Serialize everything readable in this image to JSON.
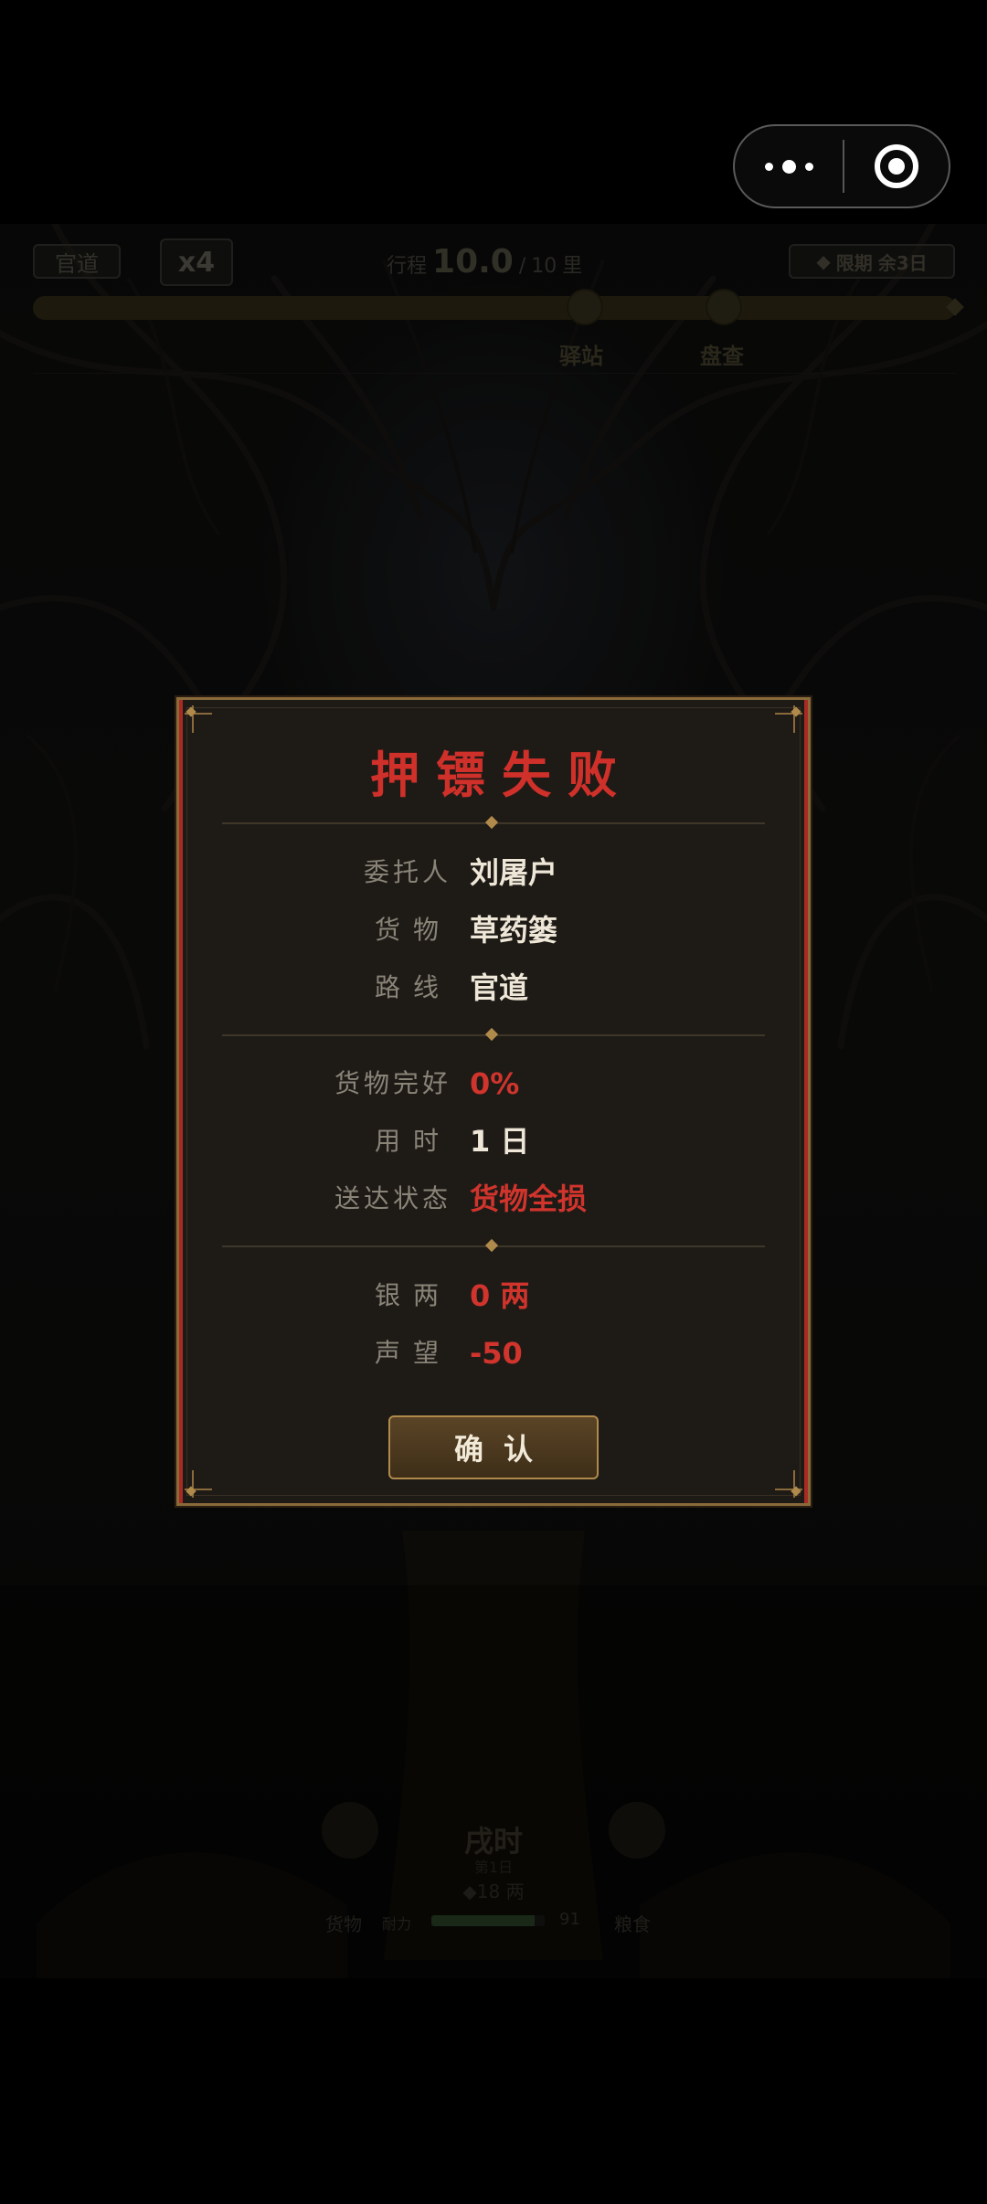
{
  "capsule": {
    "more_icon": "more-dots-icon",
    "close_icon": "target-circle-icon"
  },
  "topbar": {
    "route": "官道",
    "speed": "x4",
    "distance_label": "行程",
    "distance_current": "10.0",
    "distance_sep": "/",
    "distance_total": "10",
    "distance_unit": "里",
    "deadline_label": "限期",
    "deadline_remaining": "余3日",
    "progress": 1.0,
    "markers": [
      {
        "label": "驿站"
      },
      {
        "label": "盘查"
      }
    ]
  },
  "modal": {
    "title": "押镖失败",
    "client_label": "委托人",
    "client_value": "刘屠户",
    "cargo_label": "货物",
    "cargo_value": "草药篓",
    "route_label": "路线",
    "route_value": "官道",
    "intact_label": "货物完好",
    "intact_value": "0%",
    "time_label": "用时",
    "time_value": "1 日",
    "status_label": "送达状态",
    "status_value": "货物全损",
    "silver_label": "银两",
    "silver_value": "0 两",
    "fame_label": "声望",
    "fame_value": "-50",
    "confirm_label": "确认"
  },
  "hud": {
    "time_of_day": "戌时",
    "day": "第1日",
    "silver": "◆18 两",
    "cargo_label": "货物",
    "durability_label": "耐力",
    "durability_value": "91",
    "durability_fraction": 0.91,
    "food_label": "粮食"
  },
  "colors": {
    "accent_red": "#d0302a",
    "frame_gold": "#8a6a3a",
    "panel_bg": "#1e1b17"
  }
}
